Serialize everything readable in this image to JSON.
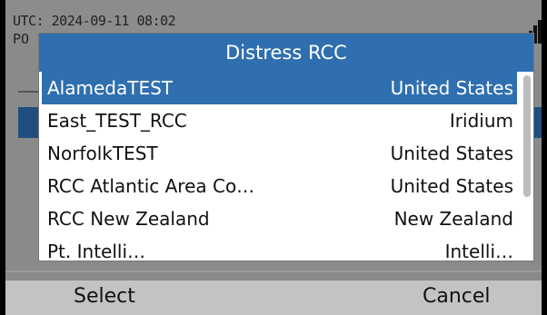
{
  "background": {
    "utc_text": "UTC:  2024-09-11  08:02",
    "po_text": "PO"
  },
  "dialog": {
    "title": "Distress RCC",
    "items": [
      {
        "name": "AlamedaTEST",
        "country": "United States",
        "selected": true
      },
      {
        "name": "East_TEST_RCC",
        "country": "Iridium",
        "selected": false
      },
      {
        "name": "NorfolkTEST",
        "country": "United States",
        "selected": false
      },
      {
        "name": "RCC Atlantic Area Co…",
        "country": "United States",
        "selected": false
      },
      {
        "name": "RCC New Zealand",
        "country": "New Zealand",
        "selected": false
      },
      {
        "name": "Pt. Intelli…",
        "country": "Intelli…",
        "selected": false
      }
    ]
  },
  "softkeys": {
    "left": "Select",
    "right": "Cancel"
  },
  "colors": {
    "title_bar": "#2f6fb0",
    "selection": "#2f6fb0",
    "bottom_bar": "#c3c3c3"
  }
}
